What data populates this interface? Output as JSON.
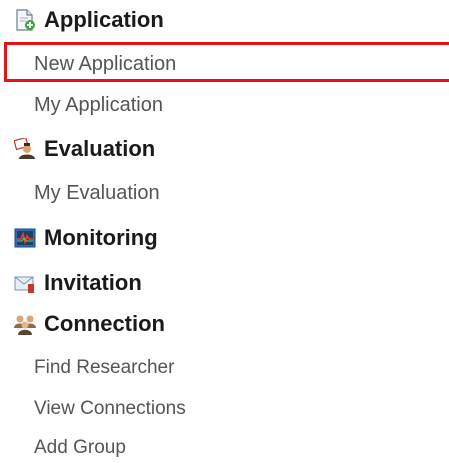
{
  "nav": {
    "application": {
      "label": "Application",
      "icon": "document-add-icon",
      "items": [
        "New Application",
        "My Application"
      ],
      "selected": "New Application"
    },
    "evaluation": {
      "label": "Evaluation",
      "icon": "evaluator-icon",
      "items": [
        "My Evaluation"
      ]
    },
    "monitoring": {
      "label": "Monitoring",
      "icon": "monitor-chart-icon"
    },
    "invitation": {
      "label": "Invitation",
      "icon": "envelope-icon"
    },
    "connection": {
      "label": "Connection",
      "icon": "people-group-icon",
      "items": [
        "Find Researcher",
        "View Connections",
        "Add Group"
      ]
    }
  },
  "colors": {
    "highlight": "#e8101a",
    "heading": "#1a1a1a",
    "item": "#555555"
  }
}
